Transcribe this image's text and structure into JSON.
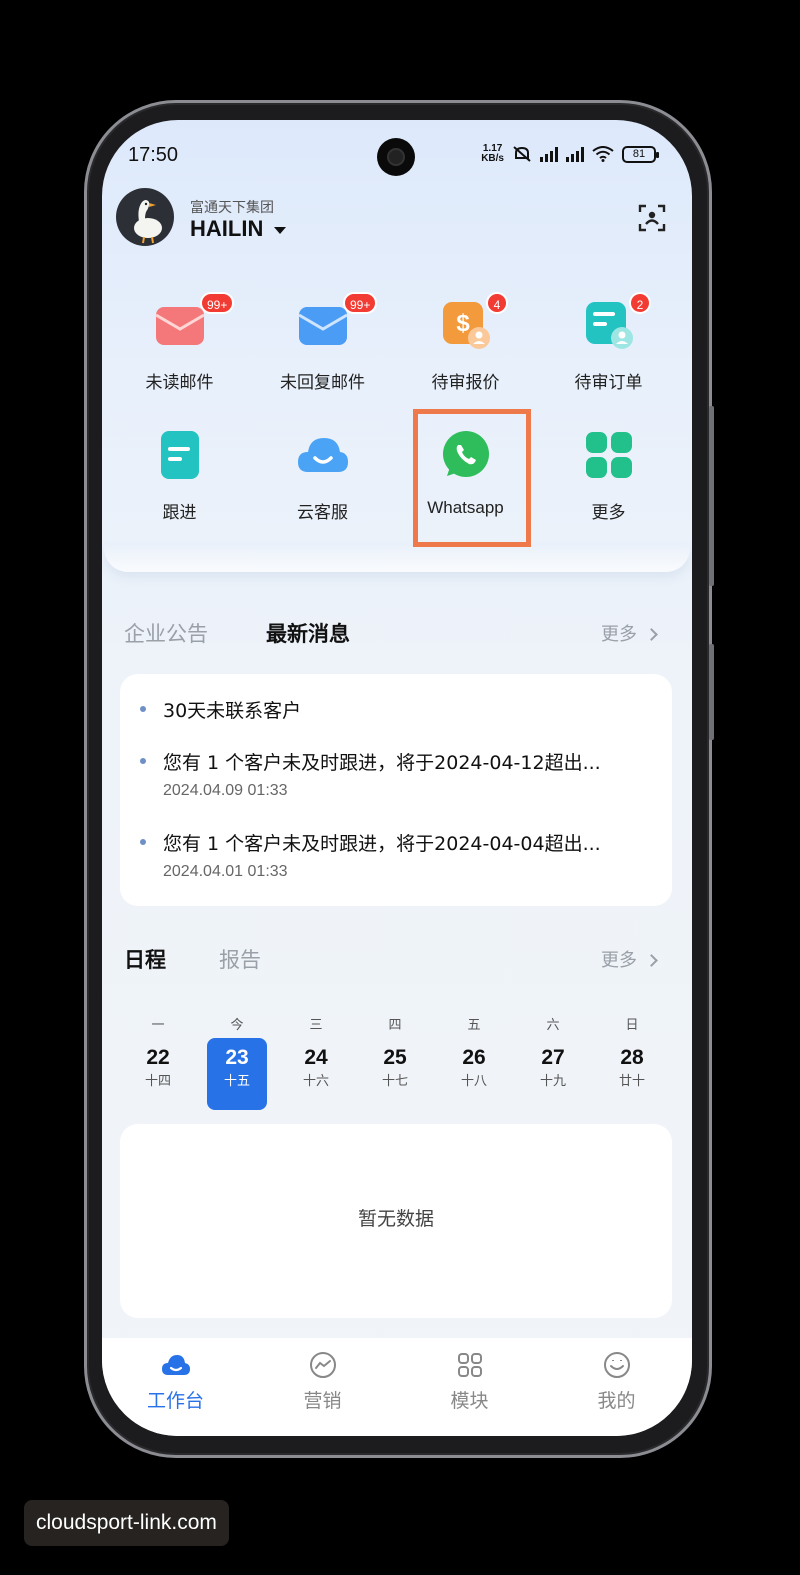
{
  "status_bar": {
    "time": "17:50",
    "net_speed_value": "1.17",
    "net_speed_unit": "KB/s",
    "battery": "81"
  },
  "header": {
    "company": "富通天下集团",
    "user_name": "HAILIN"
  },
  "shortcuts": [
    {
      "label": "未读邮件",
      "badge": "99+",
      "icon": "mail-icon",
      "color": "#f4787a"
    },
    {
      "label": "未回复邮件",
      "badge": "99+",
      "icon": "mail-icon",
      "color": "#4a9cf5"
    },
    {
      "label": "待审报价",
      "badge": "4",
      "icon": "quote-icon",
      "color": "#f39a3c"
    },
    {
      "label": "待审订单",
      "badge": "2",
      "icon": "order-icon",
      "color": "#22c3c0"
    },
    {
      "label": "跟进",
      "icon": "followup-icon",
      "color": "#22c3c0"
    },
    {
      "label": "云客服",
      "icon": "cloud-icon",
      "color": "#4aa3f5"
    },
    {
      "label": "Whatsapp",
      "icon": "whatsapp-icon",
      "color": "#2fbd5b"
    },
    {
      "label": "更多",
      "icon": "grid-icon",
      "color": "#22c08a"
    }
  ],
  "news": {
    "tabs": [
      "企业公告",
      "最新消息"
    ],
    "active_tab": "最新消息",
    "more": "更多",
    "items": [
      {
        "title": "30天未联系客户",
        "time": ""
      },
      {
        "title": "您有 1 个客户未及时跟进，将于2024-04-12超出...",
        "time": "2024.04.09 01:33"
      },
      {
        "title": "您有 1 个客户未及时跟进，将于2024-04-04超出...",
        "time": "2024.04.01 01:33"
      }
    ]
  },
  "schedule": {
    "tabs": [
      "日程",
      "报告"
    ],
    "active_tab": "日程",
    "more": "更多",
    "days": [
      {
        "weekday": "一",
        "date": "22",
        "lunar": "十四",
        "selected": false
      },
      {
        "weekday": "今",
        "date": "23",
        "lunar": "十五",
        "selected": true
      },
      {
        "weekday": "三",
        "date": "24",
        "lunar": "十六",
        "selected": false
      },
      {
        "weekday": "四",
        "date": "25",
        "lunar": "十七",
        "selected": false
      },
      {
        "weekday": "五",
        "date": "26",
        "lunar": "十八",
        "selected": false
      },
      {
        "weekday": "六",
        "date": "27",
        "lunar": "十九",
        "selected": false
      },
      {
        "weekday": "日",
        "date": "28",
        "lunar": "廿十",
        "selected": false
      }
    ],
    "empty_text": "暂无数据"
  },
  "bottom_nav": [
    {
      "label": "工作台",
      "icon": "cloud-home-icon",
      "active": true
    },
    {
      "label": "营销",
      "icon": "marketing-icon",
      "active": false
    },
    {
      "label": "模块",
      "icon": "modules-icon",
      "active": false
    },
    {
      "label": "我的",
      "icon": "profile-icon",
      "active": false
    }
  ],
  "colors": {
    "accent": "#2872e8",
    "badge": "#f23b32",
    "highlight": "#ee7a4b"
  },
  "watermark": "cloudsport-link.com"
}
